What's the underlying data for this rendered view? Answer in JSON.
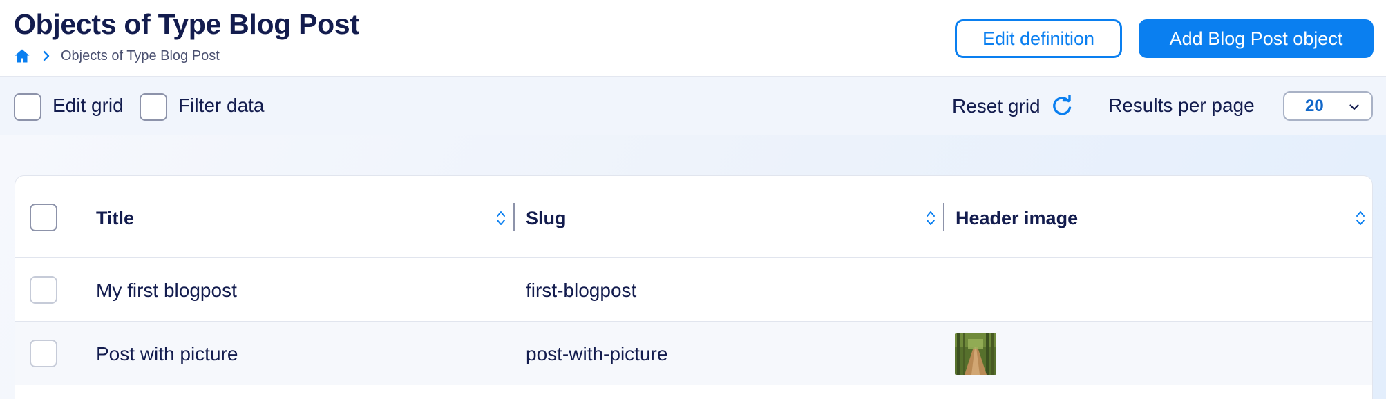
{
  "header": {
    "title": "Objects of Type Blog Post",
    "breadcrumb": {
      "home_icon": "home-icon",
      "separator_icon": "chevron-right-icon",
      "current": "Objects of Type Blog Post"
    },
    "edit_definition_label": "Edit definition",
    "add_object_label": "Add Blog Post object"
  },
  "toolbar": {
    "edit_grid_label": "Edit grid",
    "edit_grid_checked": false,
    "filter_data_label": "Filter data",
    "filter_data_checked": false,
    "reset_grid_label": "Reset grid",
    "reset_icon": "refresh-icon",
    "results_per_page_label": "Results per page",
    "results_per_page_value": "20"
  },
  "grid": {
    "columns": [
      {
        "label": "Title",
        "sortable": true
      },
      {
        "label": "Slug",
        "sortable": true
      },
      {
        "label": "Header image",
        "sortable": true
      }
    ],
    "rows": [
      {
        "title": "My first blogpost",
        "slug": "first-blogpost",
        "header_image": ""
      },
      {
        "title": "Post with picture",
        "slug": "post-with-picture",
        "header_image": "forest-path-thumbnail"
      }
    ]
  },
  "colors": {
    "accent": "#0a7ff0",
    "text": "#131c4e",
    "toolbar_bg": "#f1f5fc"
  }
}
